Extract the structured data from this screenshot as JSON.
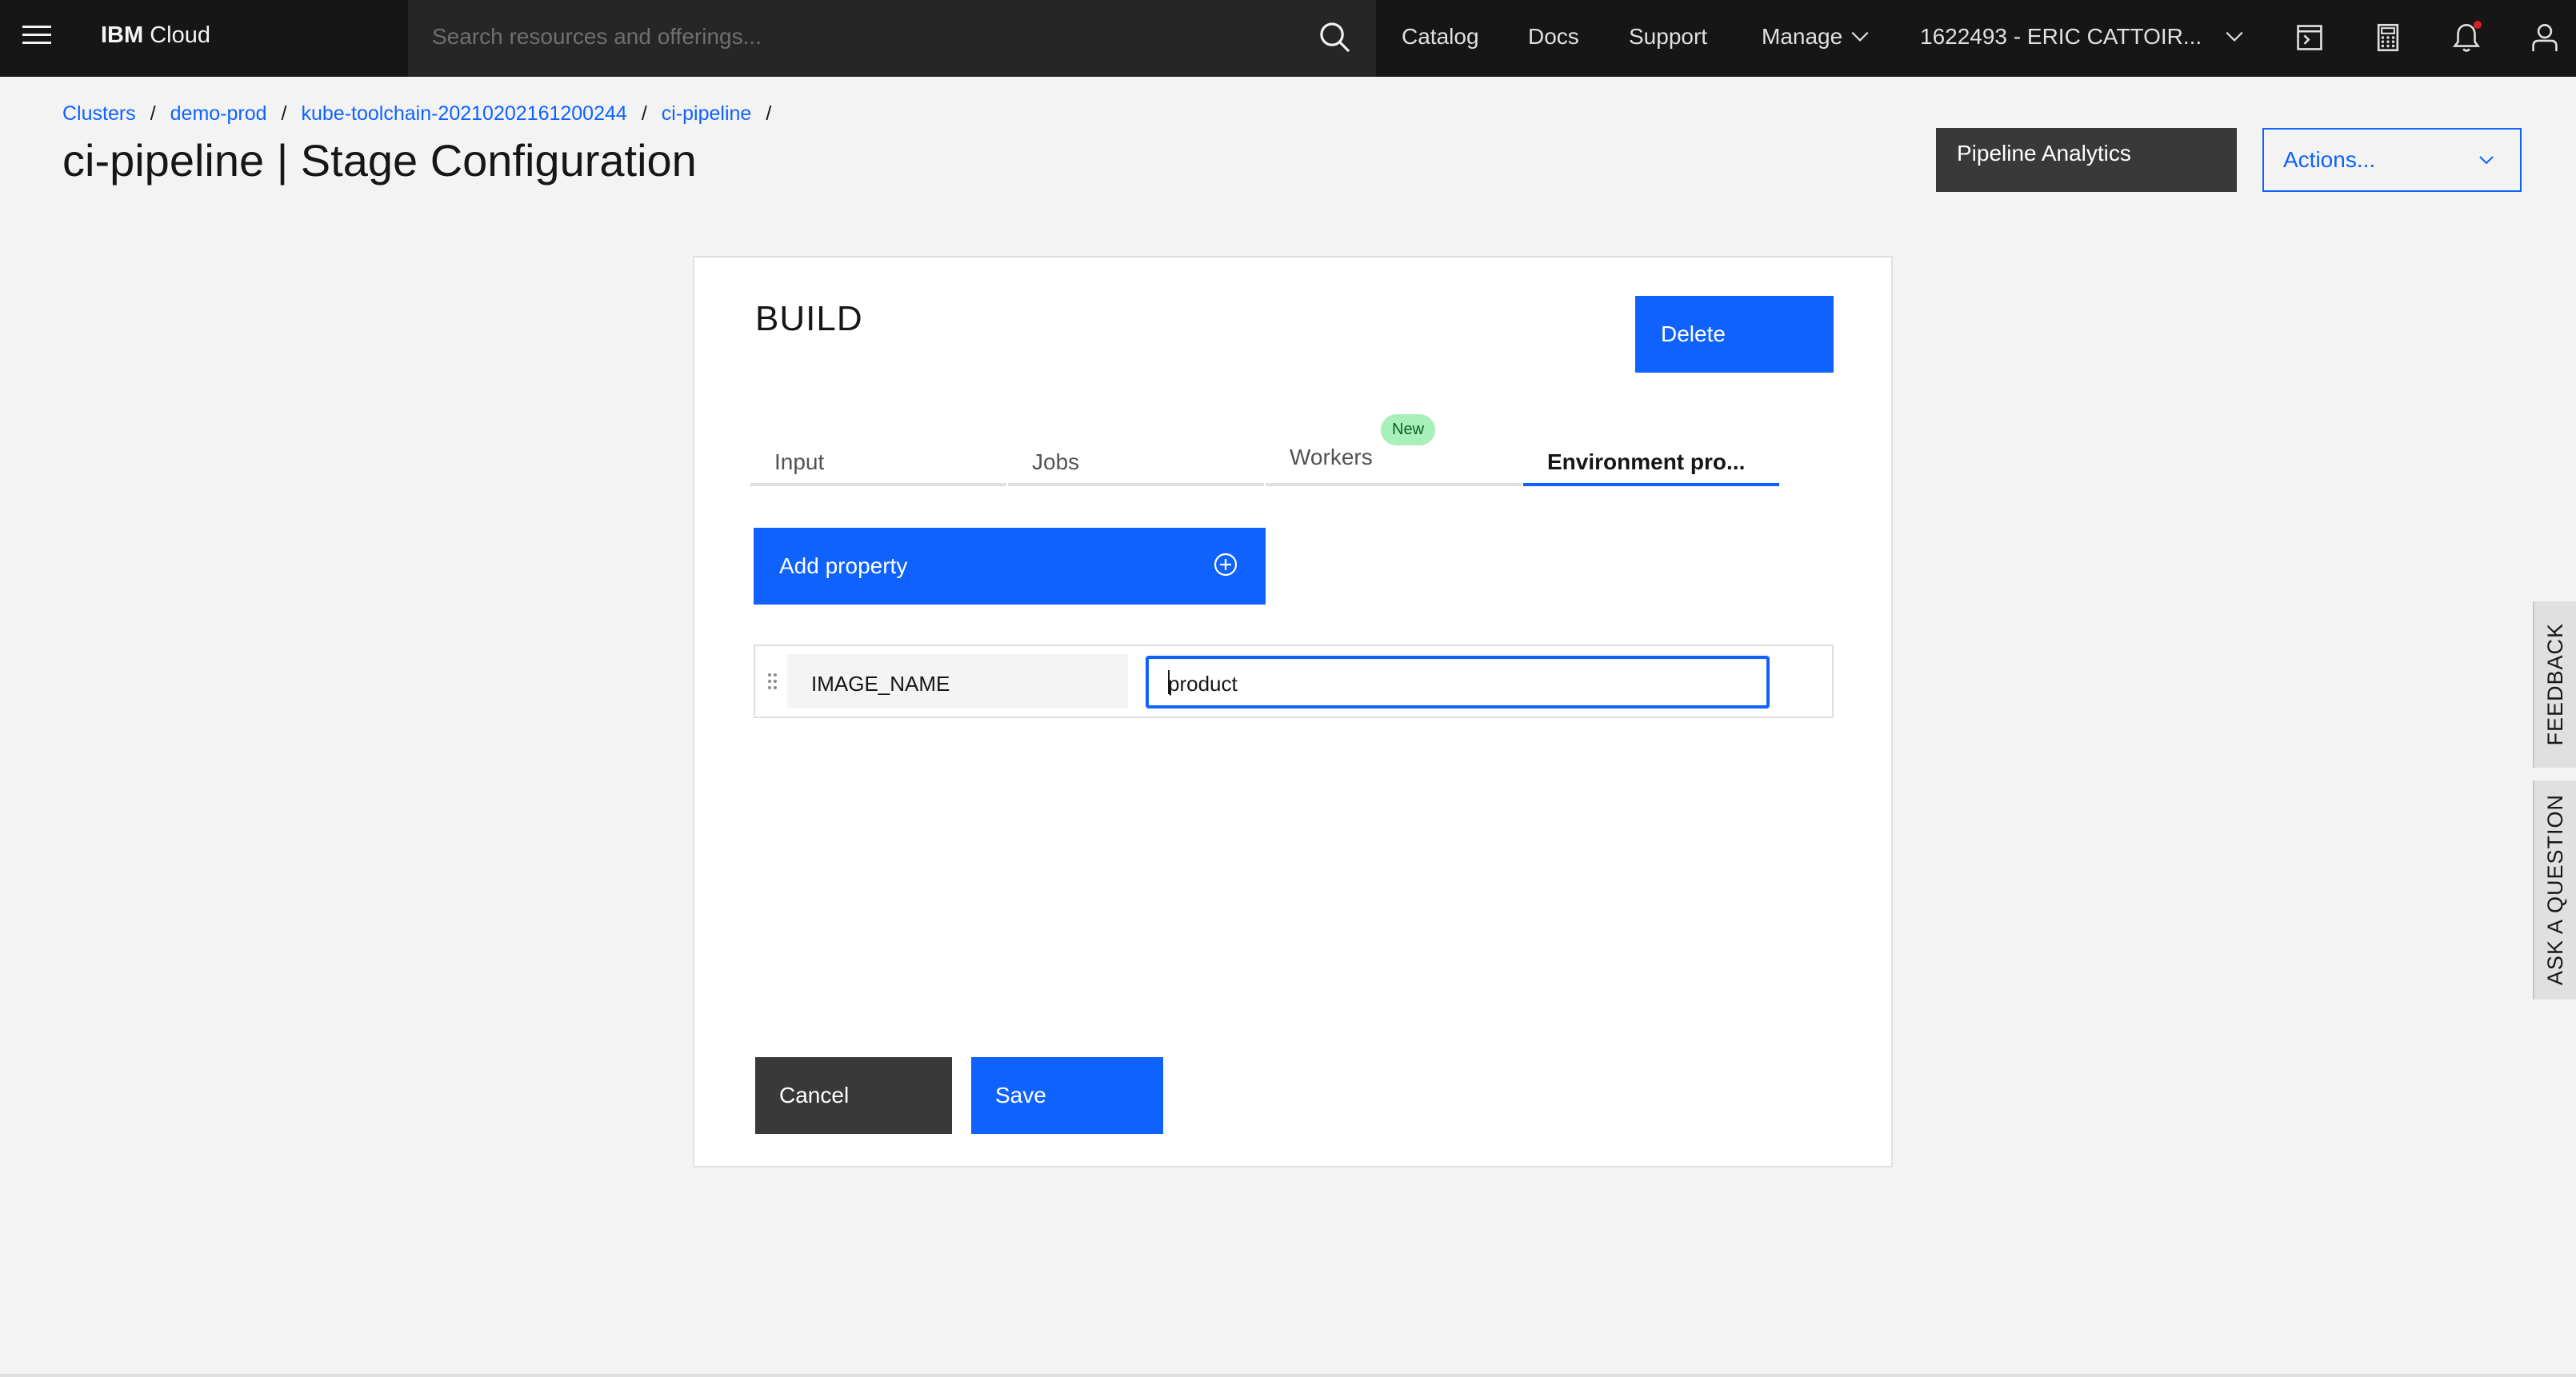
{
  "topbar": {
    "brand_bold": "IBM",
    "brand_rest": "Cloud",
    "search_placeholder": "Search resources and offerings...",
    "nav": [
      "Catalog",
      "Docs",
      "Support",
      "Manage"
    ],
    "account": "1622493 - ERIC CATTOIR..."
  },
  "breadcrumb": [
    "Clusters",
    "demo-prod",
    "kube-toolchain-20210202161200244",
    "ci-pipeline"
  ],
  "page_title": "ci-pipeline | Stage Configuration",
  "header_buttons": {
    "analytics": "Pipeline Analytics",
    "actions": "Actions..."
  },
  "stage": {
    "title": "BUILD",
    "delete_label": "Delete",
    "tabs": [
      "Input",
      "Jobs",
      "Workers",
      "Environment pro..."
    ],
    "new_tag": "New",
    "add_property_label": "Add property",
    "property": {
      "key": "IMAGE_NAME",
      "value": "product"
    },
    "cancel_label": "Cancel",
    "save_label": "Save"
  },
  "side_tabs": {
    "feedback": "FEEDBACK",
    "ask": "ASK A QUESTION"
  },
  "colors": {
    "primary": "#0f62fe",
    "topbar": "#161616",
    "notification": "#da1e28",
    "tag_new_bg": "#a7f0ba"
  }
}
